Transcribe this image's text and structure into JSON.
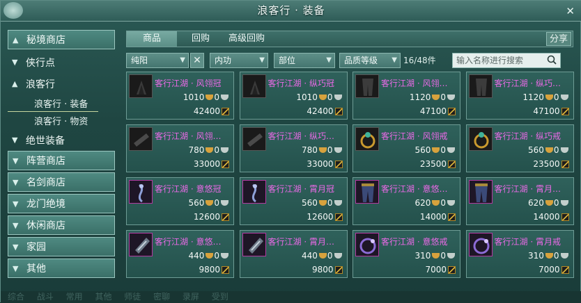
{
  "window": {
    "title": "浪客行 · 装备",
    "close_label": "✕"
  },
  "sidebar": {
    "shop_secret": "秘境商店",
    "xiashi": "侠行点",
    "langkexing": "浪客行",
    "sub_equip": "浪客行 · 装备",
    "sub_goods": "浪客行 · 物资",
    "jueshi": "绝世装备",
    "camp": "阵营商店",
    "mingjian": "名剑商店",
    "longmen": "龙门绝境",
    "leisure": "休闲商店",
    "home": "家园",
    "other": "其他"
  },
  "tabs": {
    "goods": "商品",
    "buyback": "回购",
    "adv_buyback": "高级回购",
    "share": "分享"
  },
  "filters": {
    "school": "纯阳",
    "clear": "✕",
    "attr": "内功",
    "slot": "部位",
    "quality": "品质等级",
    "count": "16/48件",
    "search_placeholder": "输入名称进行搜索"
  },
  "items": [
    {
      "name": "客行江湖 · 风翎冠",
      "gold": "1010",
      "silver": "0",
      "rep": "42400"
    },
    {
      "name": "客行江湖 · 纵巧冠",
      "gold": "1010",
      "silver": "0",
      "rep": "42400"
    },
    {
      "name": "客行江湖 · 风翎…",
      "gold": "1120",
      "silver": "0",
      "rep": "47100"
    },
    {
      "name": "客行江湖 · 纵巧…",
      "gold": "1120",
      "silver": "0",
      "rep": "47100"
    },
    {
      "name": "客行江湖 · 风翎…",
      "gold": "780",
      "silver": "0",
      "rep": "33000"
    },
    {
      "name": "客行江湖 · 纵巧…",
      "gold": "780",
      "silver": "0",
      "rep": "33000"
    },
    {
      "name": "客行江湖 · 风翎戒",
      "gold": "560",
      "silver": "0",
      "rep": "23500"
    },
    {
      "name": "客行江湖 · 纵巧戒",
      "gold": "560",
      "silver": "0",
      "rep": "23500"
    },
    {
      "name": "客行江湖 · 意悠冠",
      "gold": "560",
      "silver": "0",
      "rep": "12600"
    },
    {
      "name": "客行江湖 · 霄月冠",
      "gold": "560",
      "silver": "0",
      "rep": "12600"
    },
    {
      "name": "客行江湖 · 意悠…",
      "gold": "620",
      "silver": "0",
      "rep": "14000"
    },
    {
      "name": "客行江湖 · 霄月…",
      "gold": "620",
      "silver": "0",
      "rep": "14000"
    },
    {
      "name": "客行江湖 · 意悠…",
      "gold": "440",
      "silver": "0",
      "rep": "9800"
    },
    {
      "name": "客行江湖 · 霄月…",
      "gold": "440",
      "silver": "0",
      "rep": "9800"
    },
    {
      "name": "客行江湖 · 意悠戒",
      "gold": "310",
      "silver": "0",
      "rep": "7000"
    },
    {
      "name": "客行江湖 · 霄月戒",
      "gold": "310",
      "silver": "0",
      "rep": "7000"
    }
  ],
  "chat": {
    "text": "综合 战斗 常用 其他 师徒 密聊 录屏 受到"
  }
}
